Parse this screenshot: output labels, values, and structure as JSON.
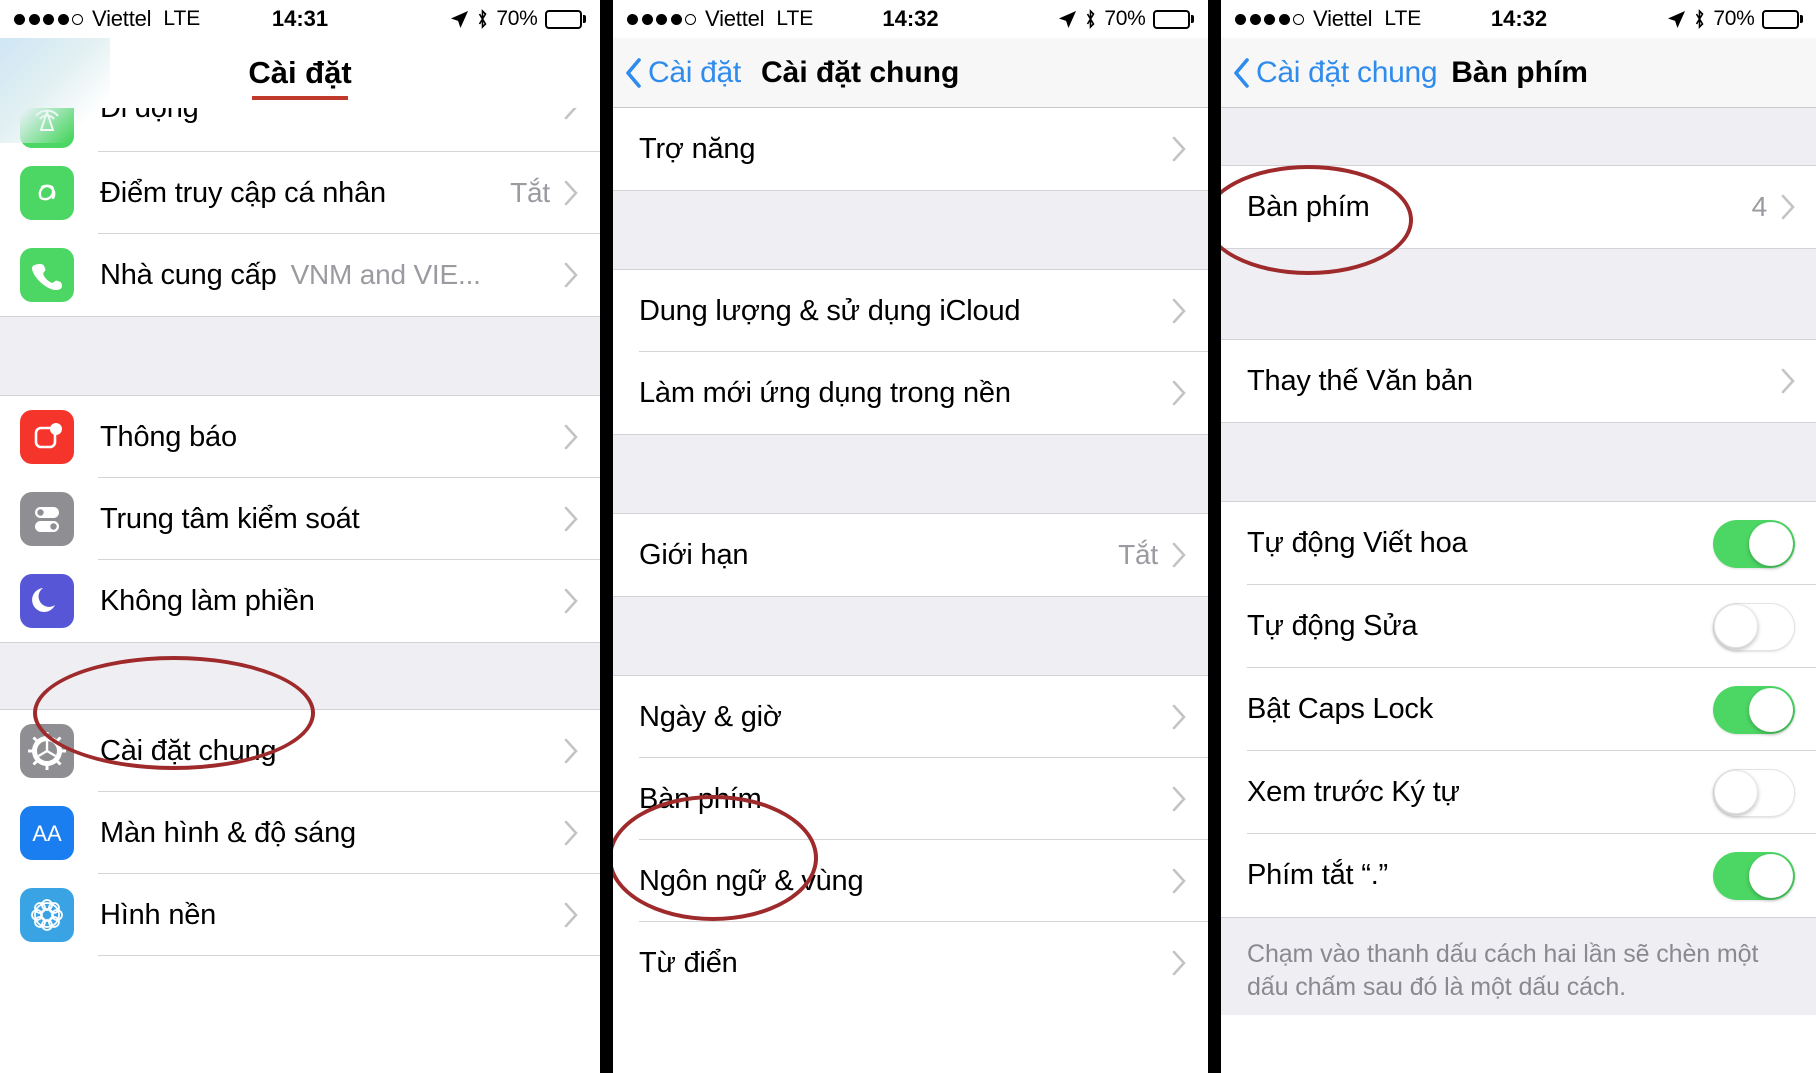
{
  "colors": {
    "accent_blue": "#2f8bec",
    "toggle_on_green": "#4cd663",
    "annotation_red": "#9e2a2b",
    "group_bg": "#eeeef3",
    "value_gray": "#9a9aa0"
  },
  "screens": [
    {
      "id": "settings",
      "status_bar": {
        "carrier": "Viettel",
        "network": "LTE",
        "time": "14:31",
        "battery_percent": "70%",
        "signal_dots_filled": 4,
        "signal_dots_total": 5,
        "icons": [
          "location-arrow-icon",
          "bluetooth-icon",
          "battery-icon"
        ]
      },
      "nav": {
        "title": "Cài đặt",
        "has_underline": true,
        "back_label": null
      },
      "groups": [
        {
          "rows": [
            {
              "icon": "cellular-icon",
              "icon_color": "#4cd663",
              "label": "Di động",
              "value": null,
              "accessory": "chevron",
              "clipped": true
            },
            {
              "icon": "hotspot-icon",
              "icon_color": "#4cd663",
              "label": "Điểm truy cập cá nhân",
              "value": "Tắt",
              "accessory": "chevron"
            },
            {
              "icon": "phone-icon",
              "icon_color": "#4cd663",
              "label": "Nhà cung cấp",
              "value": "VNM and VIE...",
              "value_inline": true,
              "accessory": "chevron"
            }
          ]
        },
        {
          "rows": [
            {
              "icon": "notifications-icon",
              "icon_color": "#f5342c",
              "label": "Thông báo",
              "value": null,
              "accessory": "chevron"
            },
            {
              "icon": "control-center-icon",
              "icon_color": "#8e8e93",
              "label": "Trung tâm kiểm soát",
              "value": null,
              "accessory": "chevron"
            },
            {
              "icon": "do-not-disturb-icon",
              "icon_color": "#5756d6",
              "label": "Không làm phiền",
              "value": null,
              "accessory": "chevron"
            }
          ]
        },
        {
          "rows": [
            {
              "icon": "gear-icon",
              "icon_color": "#8e8e93",
              "label": "Cài đặt chung",
              "value": null,
              "accessory": "chevron",
              "annotated": true
            },
            {
              "icon": "display-brightness-icon",
              "icon_color": "#1a7df0",
              "label": "Màn hình & độ sáng",
              "value": null,
              "accessory": "chevron"
            },
            {
              "icon": "wallpaper-icon",
              "icon_color": "#3aa3e3",
              "label": "Hình nền",
              "value": null,
              "accessory": "chevron"
            }
          ]
        }
      ]
    },
    {
      "id": "general",
      "status_bar": {
        "carrier": "Viettel",
        "network": "LTE",
        "time": "14:32",
        "battery_percent": "70%",
        "signal_dots_filled": 4,
        "signal_dots_total": 5,
        "icons": [
          "location-arrow-icon",
          "bluetooth-icon",
          "battery-icon"
        ]
      },
      "nav": {
        "title": "Cài đặt chung",
        "has_underline": false,
        "back_label": "Cài đặt"
      },
      "groups": [
        {
          "rows": [
            {
              "label": "Trợ năng",
              "value": null,
              "accessory": "chevron"
            }
          ]
        },
        {
          "rows": [
            {
              "label": "Dung lượng & sử dụng iCloud",
              "value": null,
              "accessory": "chevron"
            },
            {
              "label": "Làm mới ứng dụng trong nền",
              "value": null,
              "accessory": "chevron"
            }
          ]
        },
        {
          "rows": [
            {
              "label": "Giới hạn",
              "value": "Tắt",
              "accessory": "chevron"
            }
          ]
        },
        {
          "rows": [
            {
              "label": "Ngày & giờ",
              "value": null,
              "accessory": "chevron"
            },
            {
              "label": "Bàn phím",
              "value": null,
              "accessory": "chevron",
              "annotated": true
            },
            {
              "label": "Ngôn ngữ & vùng",
              "value": null,
              "accessory": "chevron"
            },
            {
              "label": "Từ điển",
              "value": null,
              "accessory": "chevron"
            }
          ]
        }
      ]
    },
    {
      "id": "keyboard",
      "status_bar": {
        "carrier": "Viettel",
        "network": "LTE",
        "time": "14:32",
        "battery_percent": "70%",
        "signal_dots_filled": 4,
        "signal_dots_total": 5,
        "icons": [
          "location-arrow-icon",
          "bluetooth-icon",
          "battery-icon"
        ]
      },
      "nav": {
        "title": "Bàn phím",
        "has_underline": false,
        "back_label": "Cài đặt chung"
      },
      "groups": [
        {
          "rows": [
            {
              "label": "Bàn phím",
              "value": "4",
              "accessory": "chevron",
              "annotated": true
            }
          ]
        },
        {
          "rows": [
            {
              "label": "Thay thế Văn bản",
              "value": null,
              "accessory": "chevron"
            }
          ]
        },
        {
          "rows": [
            {
              "label": "Tự động Viết hoa",
              "accessory": "toggle",
              "toggle_on": true
            },
            {
              "label": "Tự động Sửa",
              "accessory": "toggle",
              "toggle_on": false
            },
            {
              "label": "Bật Caps Lock",
              "accessory": "toggle",
              "toggle_on": true
            },
            {
              "label": "Xem trước Ký tự",
              "accessory": "toggle",
              "toggle_on": false
            },
            {
              "label": "Phím tắt “.”",
              "accessory": "toggle",
              "toggle_on": true
            }
          ]
        }
      ],
      "footer": "Chạm vào thanh dấu cách hai lần sẽ chèn một dấu chấm sau đó là một dấu cách."
    }
  ]
}
